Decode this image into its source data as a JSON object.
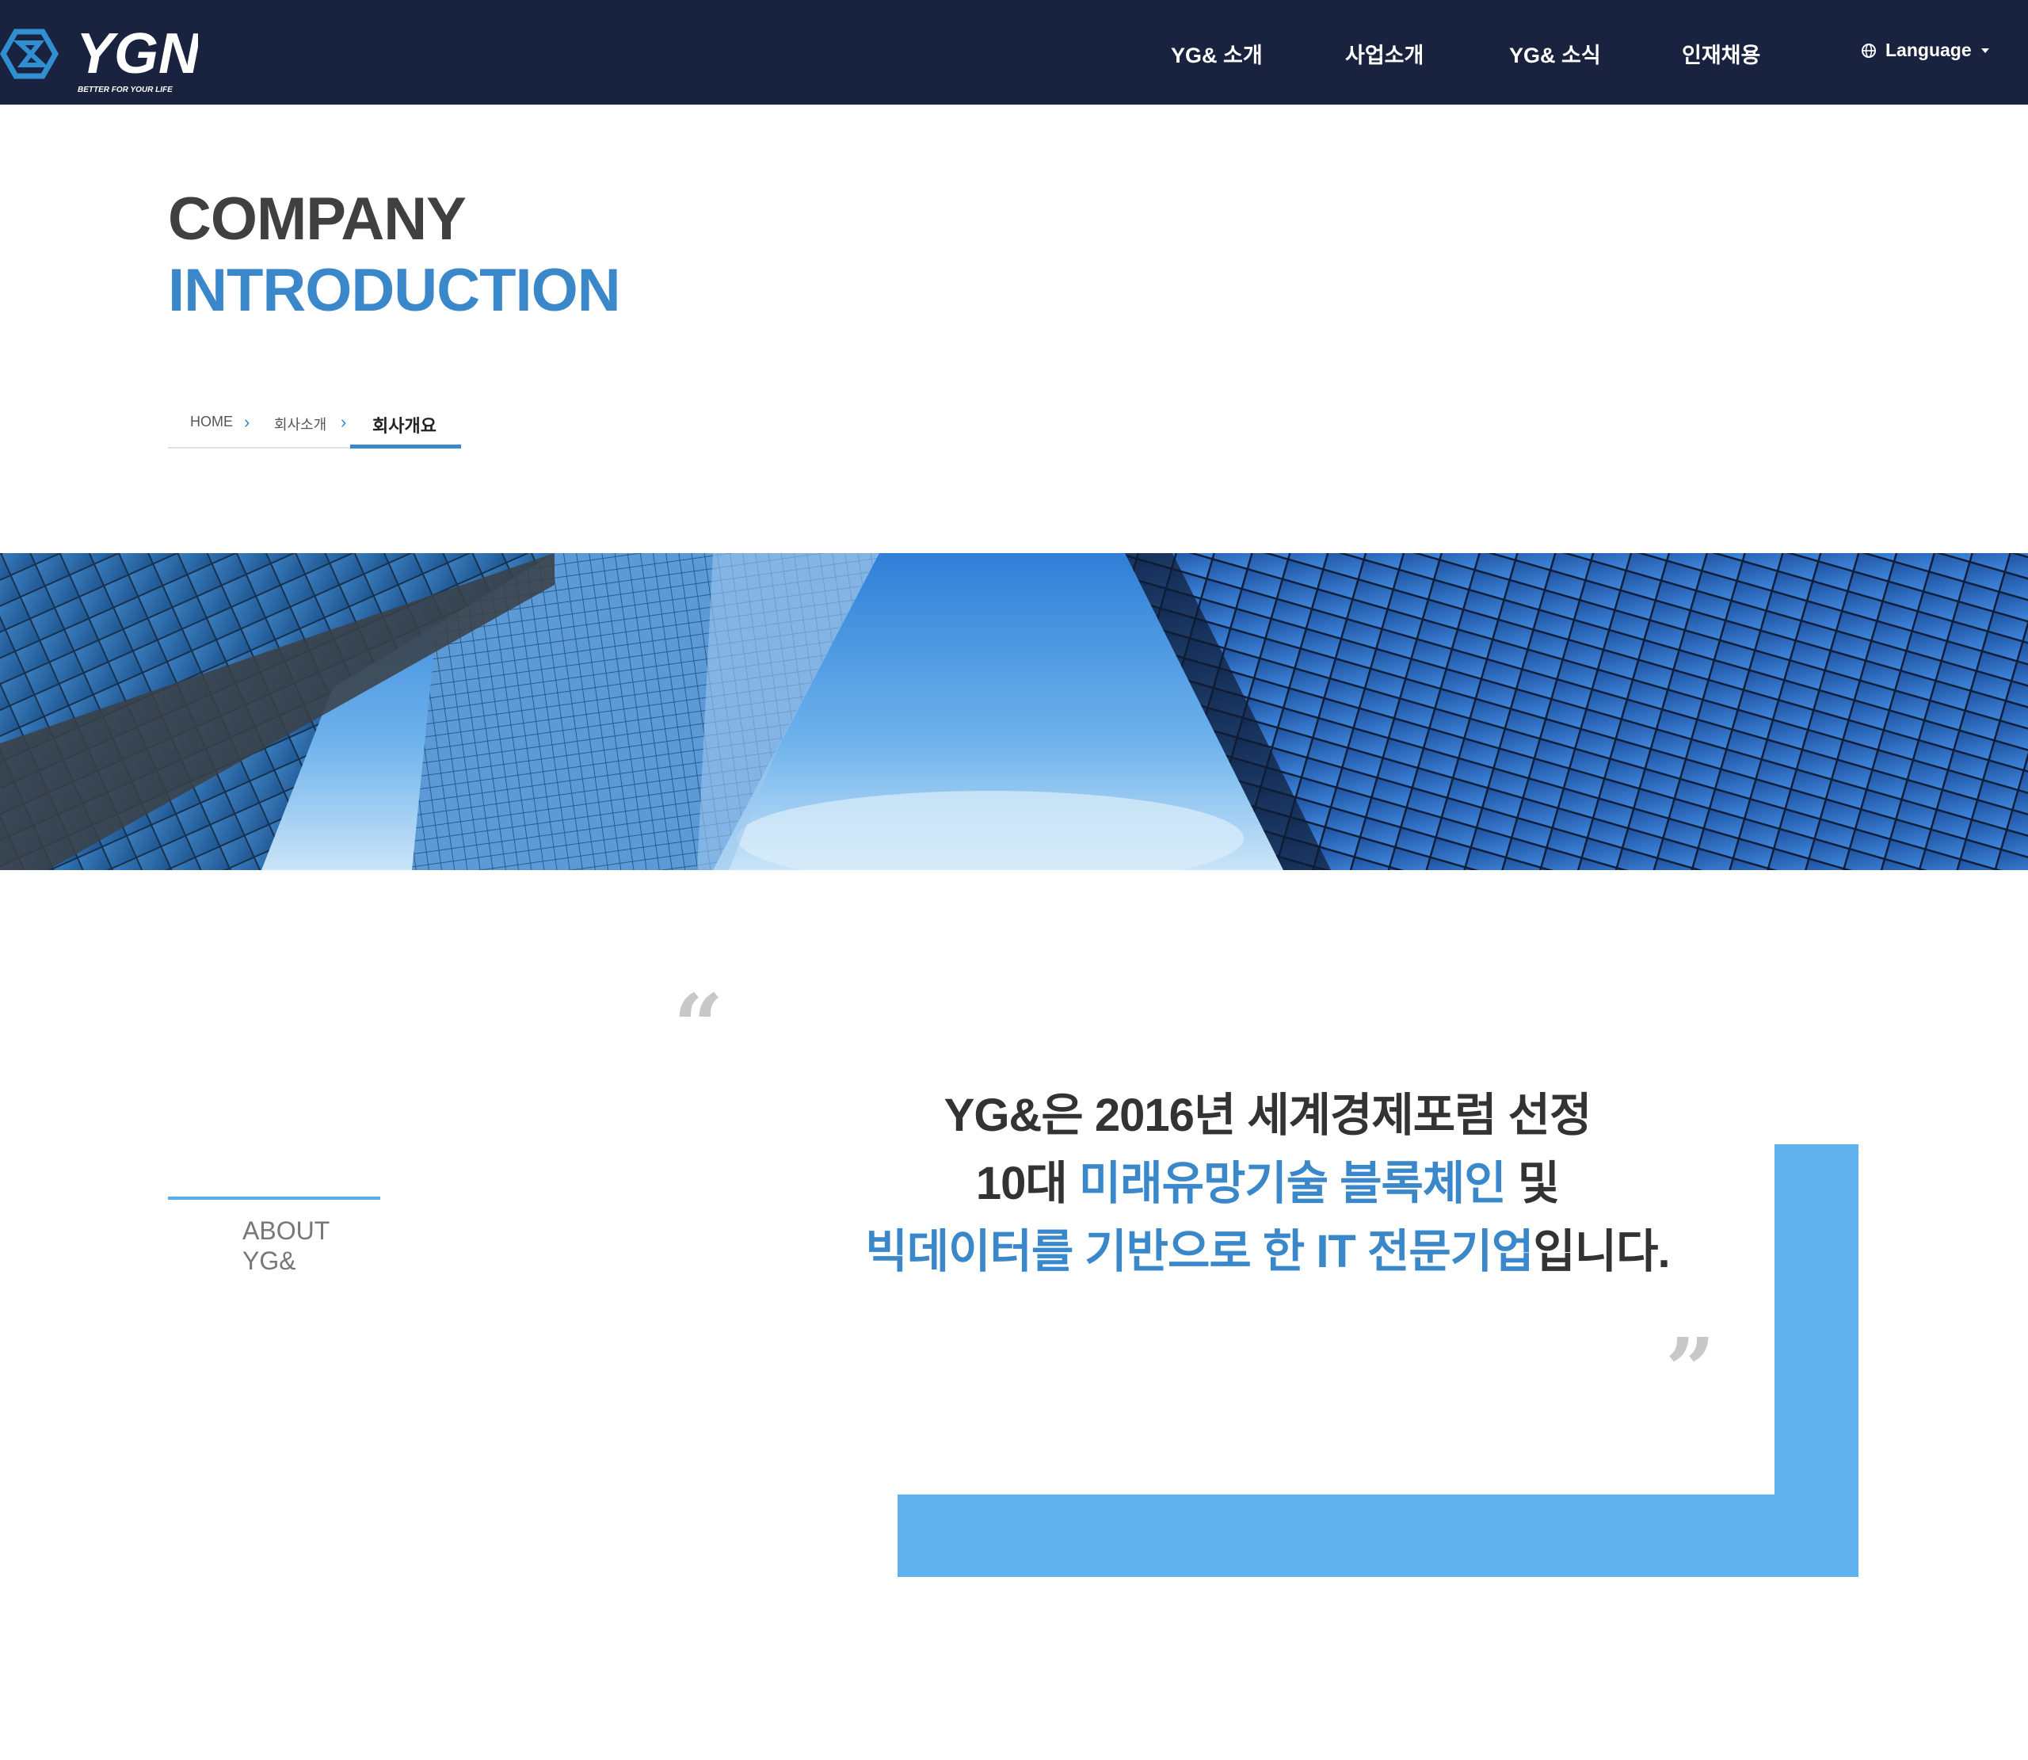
{
  "header": {
    "logo_text": "YGN",
    "logo_tagline": "BETTER FOR YOUR LIFE",
    "nav": [
      {
        "label": "YG& 소개"
      },
      {
        "label": "사업소개"
      },
      {
        "label": "YG& 소식"
      },
      {
        "label": "인재채용"
      }
    ],
    "language_label": "Language"
  },
  "title": {
    "line1": "COMPANY",
    "line2": "INTRODUCTION"
  },
  "breadcrumb": {
    "home": "HOME",
    "parent": "회사소개",
    "current": "회사개요"
  },
  "about": {
    "line1": "ABOUT",
    "line2": "YG&"
  },
  "statement": {
    "line1": "YG&은 2016년 세계경제포럼 선정",
    "line2_pre": "10대 ",
    "line2_hl": "미래유망기술 블록체인",
    "line2_post": " 및",
    "line3_hl": "빅데이터를 기반으로 한 IT 전문기업",
    "line3_post": "입니다."
  },
  "colors": {
    "header_bg": "#19223f",
    "accent_blue": "#3a88c9",
    "frame_blue": "#5fb2ee"
  }
}
